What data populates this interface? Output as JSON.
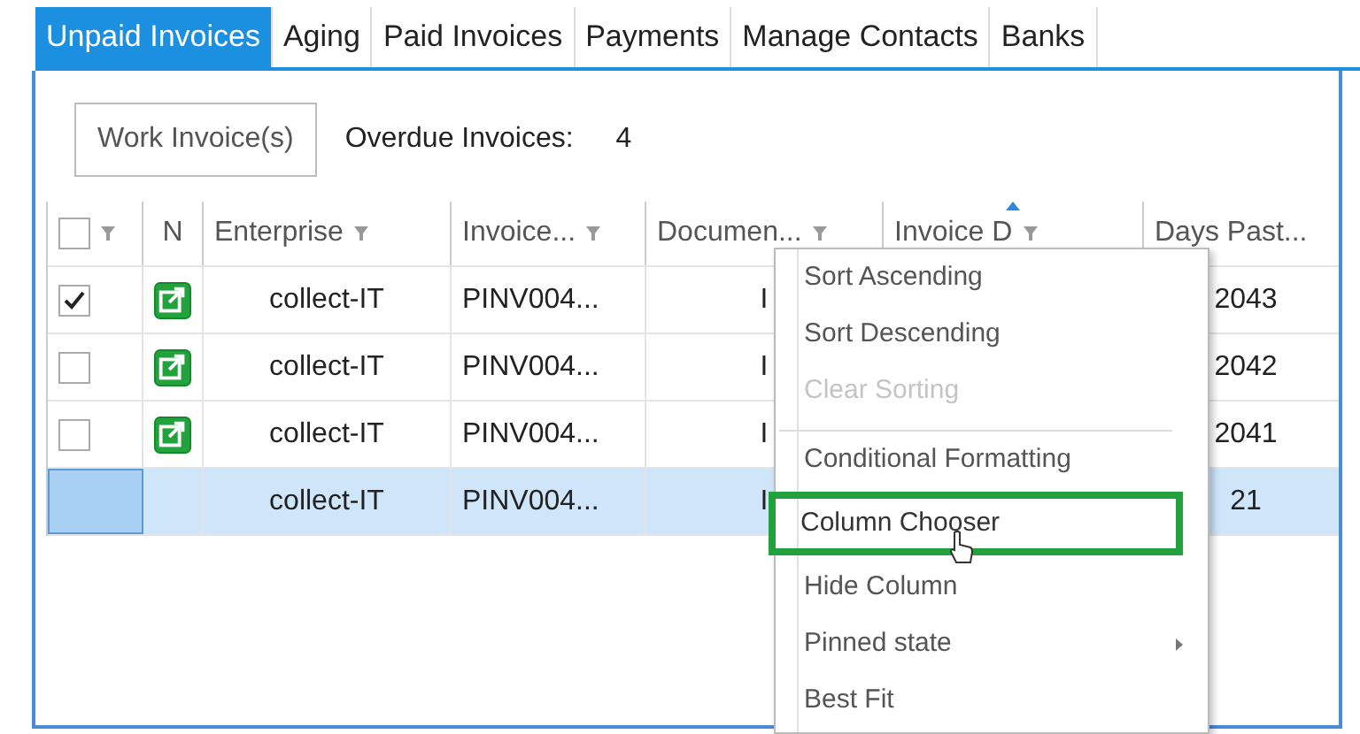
{
  "tabs": [
    {
      "label": "Unpaid Invoices",
      "selected": true
    },
    {
      "label": "Aging",
      "selected": false
    },
    {
      "label": "Paid Invoices",
      "selected": false
    },
    {
      "label": "Payments",
      "selected": false
    },
    {
      "label": "Manage Contacts",
      "selected": false
    },
    {
      "label": "Banks",
      "selected": false
    }
  ],
  "toolbar": {
    "button": "Work Invoice(s)",
    "count_label": "Overdue Invoices:",
    "count": "4"
  },
  "table": {
    "select_all_checked": false,
    "columns": [
      {
        "label": "N",
        "filter": false,
        "sorted": false
      },
      {
        "label": "Enterprise",
        "filter": true,
        "sorted": false
      },
      {
        "label": "Invoice...",
        "filter": true,
        "sorted": false
      },
      {
        "label": "Documen...",
        "filter": true,
        "sorted": false
      },
      {
        "label": "Invoice D",
        "filter": true,
        "sorted": true
      },
      {
        "label": "Days Past...",
        "filter": false,
        "sorted": false
      }
    ],
    "rows": [
      {
        "checked": true,
        "link": true,
        "selected": false,
        "enterprise": "collect-IT",
        "invoice": "PINV004...",
        "document": "I",
        "days_past": "2043"
      },
      {
        "checked": false,
        "link": true,
        "selected": false,
        "enterprise": "collect-IT",
        "invoice": "PINV004...",
        "document": "I",
        "days_past": "2042"
      },
      {
        "checked": false,
        "link": true,
        "selected": false,
        "enterprise": "collect-IT",
        "invoice": "PINV004...",
        "document": "I",
        "days_past": "2041"
      },
      {
        "link": false,
        "selected": true,
        "enterprise": "collect-IT",
        "invoice": "PINV004...",
        "document": "I",
        "days_past": "21"
      }
    ]
  },
  "context_menu": {
    "items": [
      {
        "label": "Sort Ascending",
        "disabled": false,
        "highlighted": false,
        "separator_before": false,
        "submenu": false
      },
      {
        "label": "Sort Descending",
        "disabled": false,
        "highlighted": false,
        "separator_before": false,
        "submenu": false
      },
      {
        "label": "Clear Sorting",
        "disabled": true,
        "highlighted": false,
        "separator_before": false,
        "submenu": false
      },
      {
        "label": "Conditional Formatting",
        "disabled": false,
        "highlighted": false,
        "separator_before": true,
        "submenu": false
      },
      {
        "label": "Column Chooser",
        "disabled": false,
        "highlighted": true,
        "separator_before": false,
        "submenu": false
      },
      {
        "label": "Hide Column",
        "disabled": false,
        "highlighted": false,
        "separator_before": false,
        "submenu": false
      },
      {
        "label": "Pinned state",
        "disabled": false,
        "highlighted": false,
        "separator_before": false,
        "submenu": true
      },
      {
        "label": "Best Fit",
        "disabled": false,
        "highlighted": false,
        "separator_before": false,
        "submenu": false
      }
    ]
  }
}
